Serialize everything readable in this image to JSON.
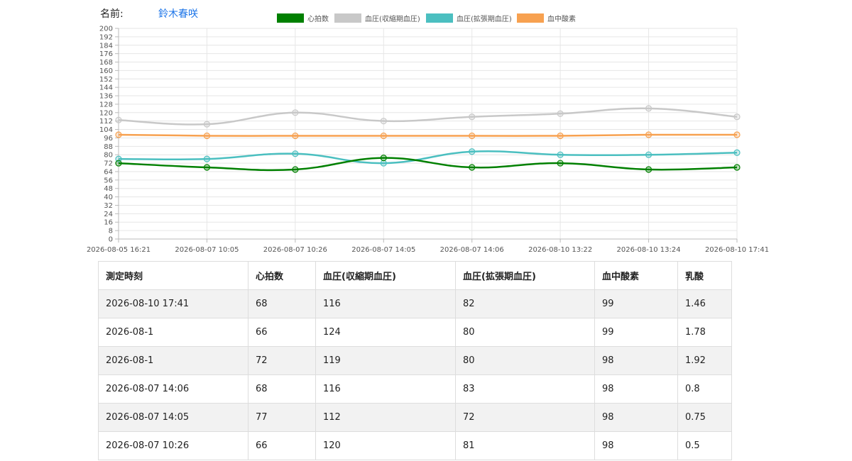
{
  "header": {
    "name_label": "名前:",
    "name_value": "鈴木春咲"
  },
  "colors": {
    "heart_rate": "#008000",
    "systolic": "#c8c8c8",
    "diastolic": "#4bbfc0",
    "spo2": "#f7a150",
    "grid": "#e6e6e6",
    "axis_text": "#555555",
    "link": "#1a73e8"
  },
  "chart_data": {
    "type": "line",
    "x": [
      "2026-08-05 16:21",
      "2026-08-07 10:05",
      "2026-08-07 10:26",
      "2026-08-07 14:05",
      "2026-08-07 14:06",
      "2026-08-10 13:22",
      "2026-08-10 13:24",
      "2026-08-10 17:41"
    ],
    "series": [
      {
        "name": "心拍数",
        "color": "#008000",
        "values": [
          72,
          68,
          66,
          77,
          68,
          72,
          66,
          68
        ]
      },
      {
        "name": "血圧(収縮期血圧)",
        "color": "#c8c8c8",
        "values": [
          113,
          109,
          120,
          112,
          116,
          119,
          124,
          116
        ]
      },
      {
        "name": "血圧(拡張期血圧)",
        "color": "#4bbfc0",
        "values": [
          76,
          76,
          81,
          72,
          83,
          80,
          80,
          82
        ]
      },
      {
        "name": "血中酸素",
        "color": "#f7a150",
        "values": [
          99,
          98,
          98,
          98,
          98,
          98,
          99,
          99
        ]
      }
    ],
    "ylim": [
      0,
      200
    ],
    "ytick_step": 8,
    "grid": true,
    "legend": "top-center",
    "title": "",
    "xlabel": "",
    "ylabel": ""
  },
  "table": {
    "headers": [
      "測定時刻",
      "心拍数",
      "血圧(収縮期血圧)",
      "血圧(拡張期血圧)",
      "血中酸素",
      "乳酸"
    ],
    "rows": [
      [
        "2026-08-10 17:41",
        "68",
        "116",
        "82",
        "99",
        "1.46"
      ],
      [
        "2026-08-1",
        "66",
        "124",
        "80",
        "99",
        "1.78"
      ],
      [
        "2026-08-1",
        "72",
        "119",
        "80",
        "98",
        "1.92"
      ],
      [
        "2026-08-07 14:06",
        "68",
        "116",
        "83",
        "98",
        "0.8"
      ],
      [
        "2026-08-07 14:05",
        "77",
        "112",
        "72",
        "98",
        "0.75"
      ],
      [
        "2026-08-07 10:26",
        "66",
        "120",
        "81",
        "98",
        "0.5"
      ]
    ]
  }
}
